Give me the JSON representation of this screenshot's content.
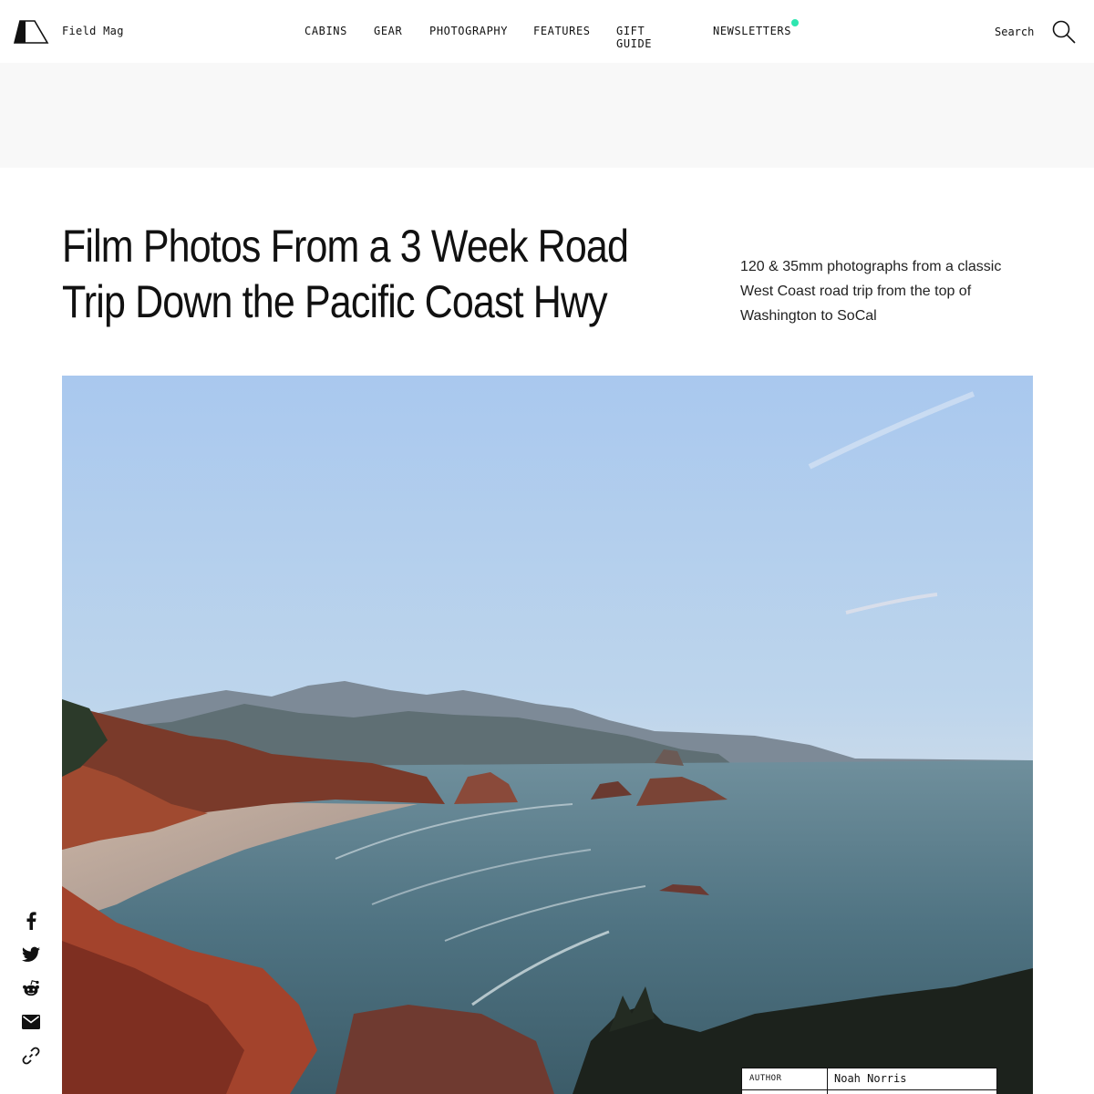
{
  "header": {
    "brand": "Field Mag",
    "nav": [
      "CABINS",
      "GEAR",
      "PHOTOGRAPHY",
      "FEATURES",
      "GIFT GUIDE",
      "NEWSLETTERS"
    ],
    "newsletter_dot_color": "#2ee6b0",
    "search_label": "Search"
  },
  "article": {
    "title_line1": "Film Photos From a 3 Week Road",
    "title_line2": "Trip Down the Pacific Coast Hwy",
    "dek_line1": "120 & 35mm photographs from a classic",
    "dek_line2": "West Coast road trip from the top of",
    "dek_line3": "Washington to SoCal"
  },
  "meta": {
    "author_label": "AUTHOR",
    "author_name": "Noah Norris"
  },
  "share": {
    "icons": [
      "facebook-icon",
      "twitter-icon",
      "reddit-icon",
      "email-icon",
      "link-icon"
    ]
  }
}
